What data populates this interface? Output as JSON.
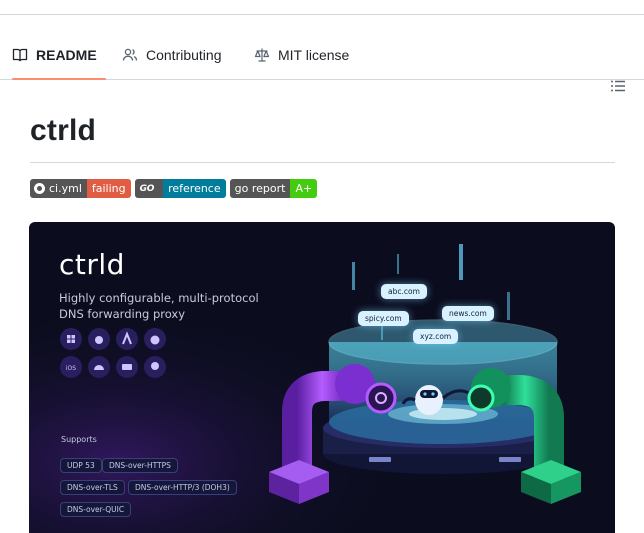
{
  "tabs": [
    {
      "label": "README",
      "icon": "book-icon",
      "active": true
    },
    {
      "label": "Contributing",
      "icon": "people-icon",
      "active": false
    },
    {
      "label": "MIT license",
      "icon": "law-icon",
      "active": false
    }
  ],
  "outline_icon": "list-unordered-icon",
  "readme": {
    "title": "ctrld",
    "badges": [
      {
        "left": "ci.yml",
        "right": "failing",
        "color": "#e05d44",
        "icon": "github-icon"
      },
      {
        "left": "GO",
        "right": "reference",
        "color": "#007d9c",
        "icon": "go-icon"
      },
      {
        "left": "go report",
        "right": "A+",
        "color": "#44cc11",
        "icon": ""
      }
    ],
    "banner": {
      "logo": "ctrld",
      "subtitle": "Highly configurable, multi-protocol DNS forwarding proxy",
      "supports_label": "Supports",
      "protocols": [
        "UDP 53",
        "DNS-over-HTTPS",
        "DNS-over-TLS",
        "DNS-over-HTTP/3 (DOH3)",
        "DNS-over-QUIC"
      ],
      "platform_icons": [
        "windows-icon",
        "apple-icon",
        "arch-icon",
        "freebsd-icon",
        "ios-icon",
        "android-icon",
        "router-icon",
        "linux-icon"
      ],
      "ios_label": "iOS",
      "domains": [
        "abc.com",
        "spicy.com",
        "news.com",
        "xyz.com"
      ],
      "colors": {
        "background": "#0b0d1e",
        "purple": "#9a3de0",
        "green": "#1fa86a",
        "cyan": "#5fe0ff"
      }
    }
  }
}
